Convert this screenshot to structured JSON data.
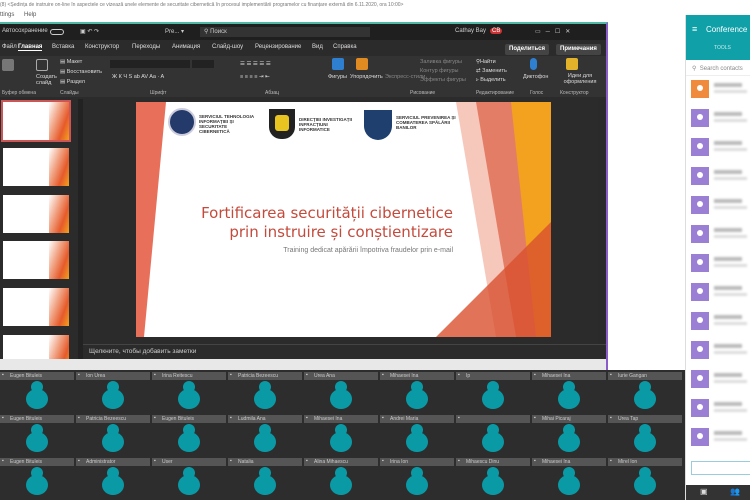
{
  "window": {
    "title": "(8) <Ședința de instruire on-line în aspectele ce vizează unele elemente de securitate cibernetică în procesul implementării programelor cu finanțare externă din 6.11.2020, ora 10:00>",
    "menu": [
      "ttings",
      "Help"
    ]
  },
  "ppt": {
    "autosave": "Автосохранение",
    "filename": "Pre... ▾",
    "search": "Поиск",
    "user": "Cathay Bay",
    "user_initials": "CB",
    "tabs": [
      "Файл",
      "Главная",
      "Вставка",
      "Конструктор",
      "Переходы",
      "Анимация",
      "Слайд-шоу",
      "Рецензирование",
      "Вид",
      "Справка"
    ],
    "share": "Поделиться",
    "comments": "Примечания",
    "ribbon": {
      "groups": [
        "Буфер обмена",
        "Слайды",
        "Шрифт",
        "Абзац",
        "Рисование",
        "Редактирование",
        "Голос",
        "Конструктор"
      ],
      "layout": "Макет",
      "reset": "Восстановить",
      "section": "Раздел",
      "new_slide": "Создать слайд",
      "shapes": "Фигуры",
      "arrange": "Упорядочить",
      "quick_styles": "Экспресс-стили",
      "fill": "Заливка фигуры",
      "outline": "Контур фигуры",
      "effects": "Эффекты фигуры",
      "find": "Найти",
      "replace": "Заменить",
      "select": "Выделить",
      "dictate": "Диктофон",
      "design_ideas": "Идеи для оформления"
    },
    "slide": {
      "logos": [
        "SERVICIUL TEHNOLOGIA INFORMAȚIEI ȘI SECURITATE CIBERNETICĂ",
        "DIRECȚIEI INVESTIGAȚII INFRACȚIUNI INFORMATICE",
        "SERVICIUL PREVENIREA ȘI COMBATEREA SPĂLĂRII BANILOR"
      ],
      "title1": "Fortificarea securității cibernetice",
      "title2": "prin instruire și conștientizare",
      "subtitle": "Training dedicat apărării împotriva fraudelor prin e-mail"
    },
    "notes": "Щелкните, чтобы добавить заметки"
  },
  "sidebar": {
    "title": "Conference",
    "tools": "TOOLS",
    "search_placeholder": "Search contacts"
  },
  "participants": [
    "Eugen Bituleis",
    "Ion Urea",
    "Irina Reitescu",
    "Patricia Bezeescu",
    "Urea Ana",
    "Mihaesei Ina",
    "Ip",
    "Mihaesei Ina",
    "Iurie Gangan",
    "Eugen Bituleis",
    "Patricia Bezeescu",
    "Eugen Bituleis",
    "Ludmila Ana",
    "Mihaesei Ina",
    "Andrei Maria",
    "",
    "Mihai Picaraj",
    "Urea Tap",
    "Eugen Bituleis",
    "Administrator",
    "User",
    "Natalia",
    "Alina Mihaescu",
    "Irina Ion",
    "Mihaescu Dinu",
    "Mihaesei Ina",
    "Mirel Ion"
  ],
  "colors": {
    "accent": "#0fa0a8",
    "slide_title": "#c0392b"
  }
}
